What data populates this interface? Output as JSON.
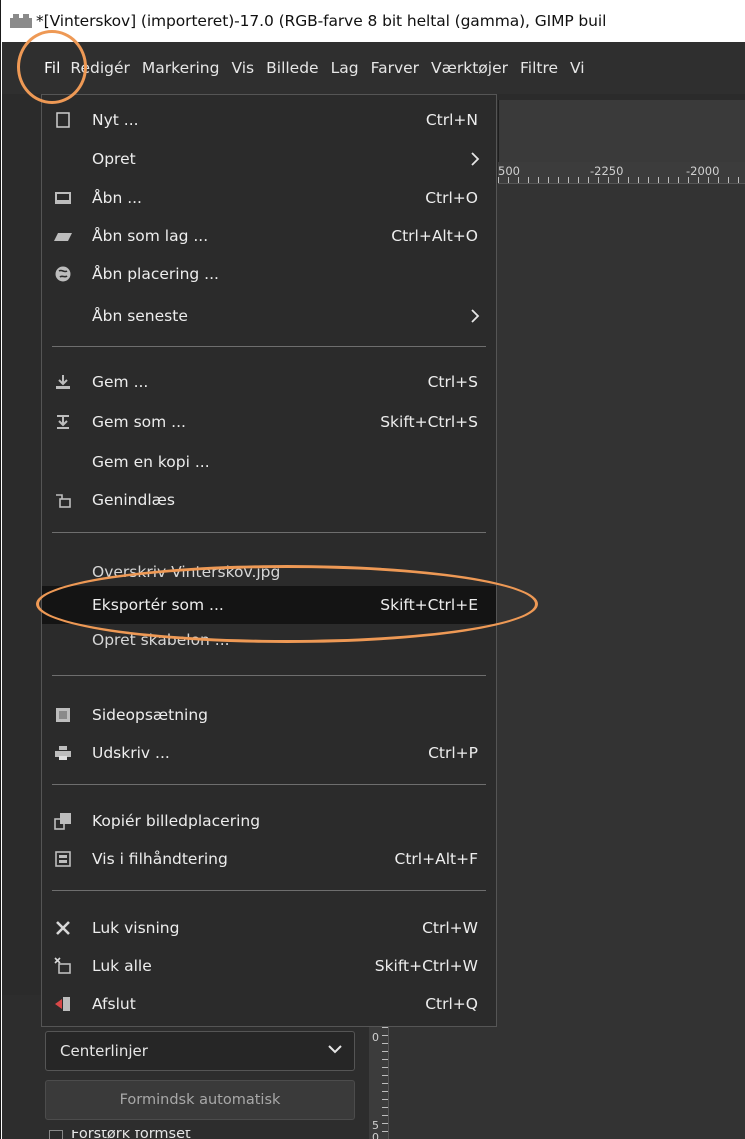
{
  "window": {
    "title": "*[Vinterskov] (importeret)-17.0 (RGB-farve 8 bit heltal (gamma), GIMP buil"
  },
  "menubar": {
    "items": [
      "Fil",
      "Redigér",
      "Markering",
      "Vis",
      "Billede",
      "Lag",
      "Farver",
      "Værktøjer",
      "Filtre",
      "Vi"
    ]
  },
  "ruler": {
    "h_labels": [
      "500",
      "-2250",
      "-2000"
    ],
    "v_labels": [
      "0",
      "5",
      "0"
    ]
  },
  "file_menu": {
    "items": [
      {
        "label": "Nyt ...",
        "shortcut": "Ctrl+N",
        "icon": "new-image-icon"
      },
      {
        "label": "Opret",
        "shortcut": "",
        "icon": "",
        "submenu": true
      },
      {
        "label": "Åbn ...",
        "shortcut": "Ctrl+O",
        "icon": "open-icon"
      },
      {
        "label": "Åbn som lag ...",
        "shortcut": "Ctrl+Alt+O",
        "icon": "open-as-layer-icon"
      },
      {
        "label": "Åbn placering ...",
        "shortcut": "",
        "icon": "globe-icon"
      },
      {
        "label": "Åbn seneste",
        "shortcut": "",
        "icon": "",
        "submenu": true
      },
      {
        "label": "Gem ...",
        "shortcut": "Ctrl+S",
        "icon": "save-icon"
      },
      {
        "label": "Gem som ...",
        "shortcut": "Skift+Ctrl+S",
        "icon": "save-as-icon"
      },
      {
        "label": "Gem en kopi ...",
        "shortcut": "",
        "icon": ""
      },
      {
        "label": "Genindlæs",
        "shortcut": "",
        "icon": "revert-icon"
      },
      {
        "label": "Overskriv Vinterskov.jpg",
        "shortcut": "",
        "icon": ""
      },
      {
        "label": "Eksportér som ...",
        "shortcut": "Skift+Ctrl+E",
        "icon": "",
        "highlighted": true
      },
      {
        "label": "Opret skabelon ...",
        "shortcut": "",
        "icon": ""
      },
      {
        "label": "Sideopsætning",
        "shortcut": "",
        "icon": "page-setup-icon"
      },
      {
        "label": "Udskriv ...",
        "shortcut": "Ctrl+P",
        "icon": "print-icon"
      },
      {
        "label": "Kopiér billedplacering",
        "shortcut": "",
        "icon": "copy-location-icon"
      },
      {
        "label": "Vis i filhåndtering",
        "shortcut": "Ctrl+Alt+F",
        "icon": "file-manager-icon"
      },
      {
        "label": "Luk visning",
        "shortcut": "Ctrl+W",
        "icon": "close-icon"
      },
      {
        "label": "Luk alle",
        "shortcut": "Skift+Ctrl+W",
        "icon": "close-all-icon"
      },
      {
        "label": "Afslut",
        "shortcut": "Ctrl+Q",
        "icon": "quit-icon"
      }
    ]
  },
  "left_panel": {
    "select_value": "Centerlinjer",
    "shrink_button": "Formindsk automatisk",
    "cutoff_checkbox_label": "Forstørk formset"
  },
  "colors": {
    "menu_bg": "#2b2b2b",
    "menubar_bg": "#2f2f2f",
    "highlight_bg": "#141414",
    "annotation": "#ee9955"
  }
}
